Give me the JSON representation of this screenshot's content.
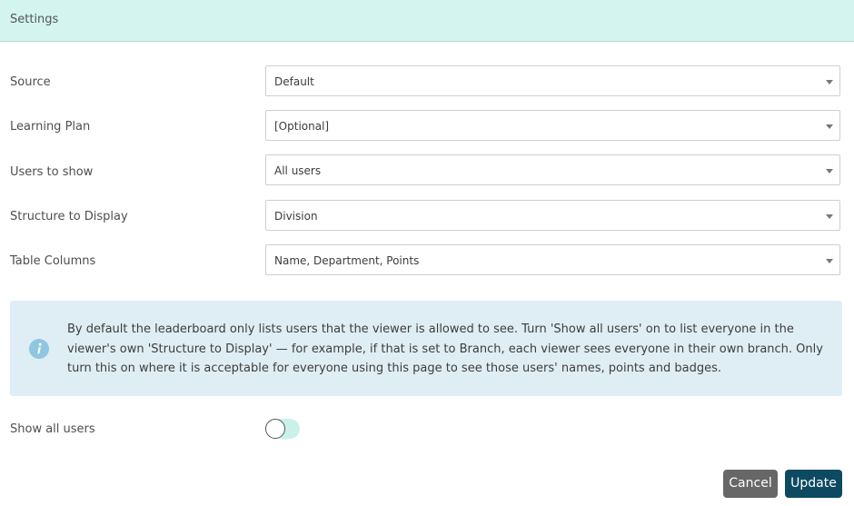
{
  "header": {
    "title": "Settings"
  },
  "fields": [
    {
      "label": "Source",
      "value": "Default"
    },
    {
      "label": "Learning Plan",
      "value": "[Optional]"
    },
    {
      "label": "Users to show",
      "value": "All users"
    },
    {
      "label": "Structure to Display",
      "value": "Division"
    },
    {
      "label": "Table Columns",
      "value": "Name, Department, Points"
    }
  ],
  "info": {
    "icon": "info-icon",
    "text": "By default the leaderboard only lists users that the viewer is allowed to see. Turn 'Show all users' on to list everyone in the viewer's own 'Structure to Display' — for example, if that is set to Branch, each viewer sees everyone in their own branch. Only turn this on where it is acceptable for everyone using this page to see those users' names, points and badges."
  },
  "show_all_users": {
    "label": "Show all users",
    "checked": false
  },
  "footer": {
    "cancel_label": "Cancel",
    "update_label": "Update"
  },
  "colors": {
    "header_bg": "#d3f4ef",
    "info_bg": "#dfeef4",
    "update_button": "#0d4a61",
    "cancel_button": "#676767"
  }
}
